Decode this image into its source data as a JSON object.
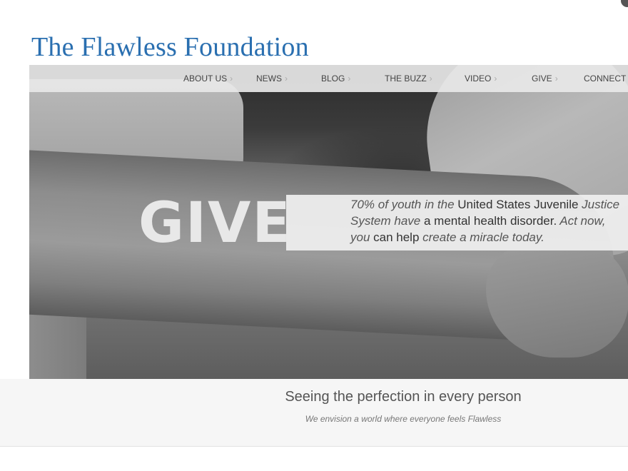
{
  "site": {
    "title": "The Flawless Foundation"
  },
  "nav": {
    "items": [
      {
        "label": "ABOUT US",
        "has_submenu": true
      },
      {
        "label": "NEWS",
        "has_submenu": true
      },
      {
        "label": "BLOG",
        "has_submenu": true
      },
      {
        "label": "THE BUZZ",
        "has_submenu": true
      },
      {
        "label": "VIDEO",
        "has_submenu": true
      },
      {
        "label": "GIVE",
        "has_submenu": true
      },
      {
        "label": "CONNECT",
        "has_submenu": false
      }
    ],
    "chevron": "›"
  },
  "hero": {
    "headline": "GIVE",
    "message_parts": [
      {
        "text": "70% of youth in the ",
        "emphasis": false
      },
      {
        "text": "United States Juvenile",
        "emphasis": true
      },
      {
        "text": " Justice System have ",
        "emphasis": false
      },
      {
        "text": "a mental health disorder.",
        "emphasis": true
      },
      {
        "text": " Act now, you ",
        "emphasis": false
      },
      {
        "text": "can help",
        "emphasis": true
      },
      {
        "text": " create a miracle today.",
        "emphasis": false
      }
    ],
    "image_icon": "holding-hands-photo"
  },
  "tagline": {
    "heading": "Seeing the perfection in every person",
    "subheading": "We envision a world where everyone feels Flawless"
  },
  "colors": {
    "brand_blue": "#2a6fb0",
    "nav_bg": "#e8e8e8",
    "band_bg": "#f6f6f6"
  }
}
